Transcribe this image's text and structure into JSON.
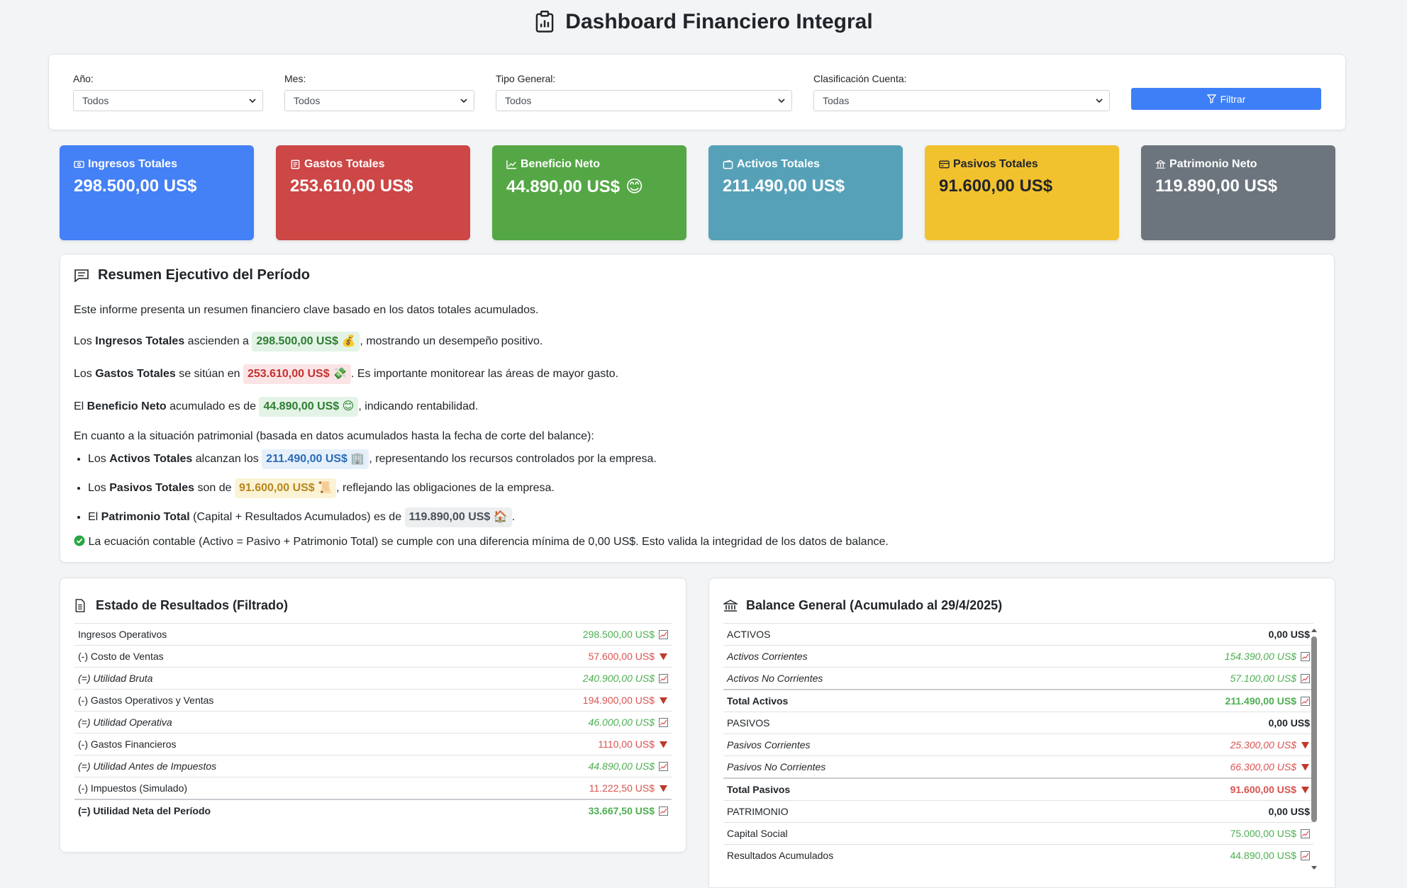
{
  "title": "Dashboard Financiero Integral",
  "filters": {
    "year": {
      "label": "Año:",
      "value": "Todos"
    },
    "month": {
      "label": "Mes:",
      "value": "Todos"
    },
    "type": {
      "label": "Tipo General:",
      "value": "Todos"
    },
    "classification": {
      "label": "Clasificación Cuenta:",
      "value": "Todas"
    },
    "button": "Filtrar"
  },
  "kpis": [
    {
      "label": "Ingresos Totales",
      "value": "298.500,00 US$",
      "color": "#4480f6",
      "icon": "money-icon"
    },
    {
      "label": "Gastos Totales",
      "value": "253.610,00 US$",
      "color": "#cc4746",
      "icon": "receipt-icon"
    },
    {
      "label": "Beneficio Neto",
      "value": "44.890,00 US$",
      "emoji": "😊",
      "color": "#55a746",
      "icon": "chart-up-icon"
    },
    {
      "label": "Activos Totales",
      "value": "211.490,00 US$",
      "color": "#56a1b8",
      "icon": "wallet-icon"
    },
    {
      "label": "Pasivos Totales",
      "value": "91.600,00 US$",
      "color": "#f2c12e",
      "icon": "card-icon"
    },
    {
      "label": "Patrimonio Neto",
      "value": "119.890,00 US$",
      "color": "#6c757d",
      "icon": "bank-icon"
    }
  ],
  "summary": {
    "title": "Resumen Ejecutivo del Período",
    "intro": "Este informe presenta un resumen financiero clave basado en los datos totales acumulados.",
    "l1_pre": "Los ",
    "l1_bold": "Ingresos Totales",
    "l1_mid": " ascienden a ",
    "l1_val": "298.500,00 US$ 💰",
    "l1_post": ", mostrando un desempeño positivo.",
    "l2_pre": "Los ",
    "l2_bold": "Gastos Totales",
    "l2_mid": " se sitúan en ",
    "l2_val": "253.610,00 US$ 💸",
    "l2_post": ". Es importante monitorear las áreas de mayor gasto.",
    "l3_pre": "El ",
    "l3_bold": "Beneficio Neto",
    "l3_mid": " acumulado es de ",
    "l3_val": "44.890,00 US$ 😊",
    "l3_post": ", indicando rentabilidad.",
    "patrimonial": "En cuanto a la situación patrimonial (basada en datos acumulados hasta la fecha de corte del balance):",
    "b1_pre": "Los ",
    "b1_bold": "Activos Totales",
    "b1_mid": " alcanzan los ",
    "b1_val": "211.490,00 US$ 🏢",
    "b1_post": ", representando los recursos controlados por la empresa.",
    "b2_pre": "Los ",
    "b2_bold": "Pasivos Totales",
    "b2_mid": " son de ",
    "b2_val": "91.600,00 US$ 📜",
    "b2_post": ", reflejando las obligaciones de la empresa.",
    "b3_pre": "El ",
    "b3_bold": "Patrimonio Total",
    "b3_mid": " (Capital + Resultados Acumulados) es de ",
    "b3_val": "119.890,00 US$ 🏠",
    "b3_post": ".",
    "equation": "La ecuación contable (Activo = Pasivo + Patrimonio Total) se cumple con una diferencia mínima de 0,00 US$. Esto valida la integridad de los datos de balance."
  },
  "income": {
    "title": "Estado de Resultados (Filtrado)",
    "rows": [
      {
        "label": "Ingresos Operativos",
        "value": "298.500,00 US$"
      },
      {
        "label": "(-) Costo de Ventas",
        "value": "57.600,00 US$"
      },
      {
        "label": "(=) Utilidad Bruta",
        "value": "240.900,00 US$"
      },
      {
        "label": "(-) Gastos Operativos y Ventas",
        "value": "194.900,00 US$"
      },
      {
        "label": "(=) Utilidad Operativa",
        "value": "46.000,00 US$"
      },
      {
        "label": "(-) Gastos Financieros",
        "value": "1110,00 US$"
      },
      {
        "label": "(=) Utilidad Antes de Impuestos",
        "value": "44.890,00 US$"
      },
      {
        "label": "(-) Impuestos (Simulado)",
        "value": "11.222,50 US$"
      },
      {
        "label": "(=) Utilidad Neta del Período",
        "value": "33.667,50 US$"
      }
    ]
  },
  "balance": {
    "title": "Balance General (Acumulado al 29/4/2025)",
    "rows": [
      {
        "label": "ACTIVOS",
        "value": "0,00 US$"
      },
      {
        "label": "Activos Corrientes",
        "value": "154.390,00 US$"
      },
      {
        "label": "Activos No Corrientes",
        "value": "57.100,00 US$"
      },
      {
        "label": "Total Activos",
        "value": "211.490,00 US$"
      },
      {
        "label": "PASIVOS",
        "value": "0,00 US$"
      },
      {
        "label": "Pasivos Corrientes",
        "value": "25.300,00 US$"
      },
      {
        "label": "Pasivos No Corrientes",
        "value": "66.300,00 US$"
      },
      {
        "label": "Total Pasivos",
        "value": "91.600,00 US$"
      },
      {
        "label": "PATRIMONIO",
        "value": "0,00 US$"
      },
      {
        "label": "Capital Social",
        "value": "75.000,00 US$"
      },
      {
        "label": "Resultados Acumulados",
        "value": "44.890,00 US$"
      }
    ]
  }
}
